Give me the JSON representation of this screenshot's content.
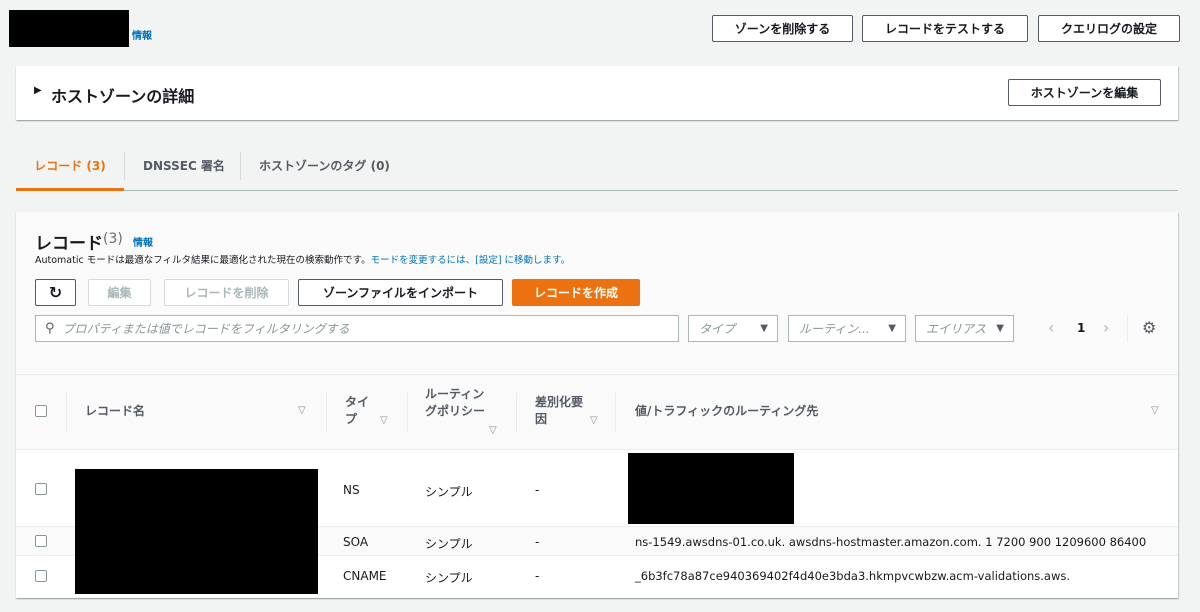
{
  "header": {
    "info_link": "情報",
    "buttons": {
      "delete_zone": "ゾーンを削除する",
      "test_record": "レコードをテストする",
      "query_log": "クエリログの設定"
    }
  },
  "details": {
    "title": "ホストゾーンの詳細",
    "edit_button": "ホストゾーンを編集"
  },
  "tabs": [
    {
      "label": "レコード (3)",
      "active": true
    },
    {
      "label": "DNSSEC 署名"
    },
    {
      "label": "ホストゾーンのタグ (0)"
    }
  ],
  "records": {
    "title": "レコード",
    "count": "(3)",
    "info_link": "情報",
    "description": "Automatic モードは最適なフィルタ結果に最適化された現在の検索動作です。",
    "description_link": "モードを変更するには、[設定] に移動します。",
    "buttons": {
      "edit": "編集",
      "delete": "レコードを削除",
      "import": "ゾーンファイルをインポート",
      "create": "レコードを作成"
    },
    "search_placeholder": "プロパティまたは値でレコードをフィルタリングする",
    "filters": {
      "type": "タイプ",
      "routing": "ルーティン...",
      "alias": "エイリアス"
    },
    "page": "1",
    "columns": {
      "name": "レコード名",
      "type": "タイプ",
      "routing": "ルーティングポリシー",
      "diff": "差別化要因",
      "value": "値/トラフィックのルーティング先"
    },
    "rows": [
      {
        "type": "NS",
        "routing": "シンプル",
        "diff": "-",
        "value": ""
      },
      {
        "type": "SOA",
        "routing": "シンプル",
        "diff": "-",
        "value": "ns-1549.awsdns-01.co.uk. awsdns-hostmaster.amazon.com. 1 7200 900 1209600 86400"
      },
      {
        "type": "CNAME",
        "routing": "シンプル",
        "diff": "-",
        "value": "_6b3fc78a87ce940369402f4d40e3bda3.hkmpvcwbzw.acm-validations.aws."
      }
    ]
  },
  "colors": {
    "accent": "#ec7211",
    "link": "#0073bb"
  }
}
